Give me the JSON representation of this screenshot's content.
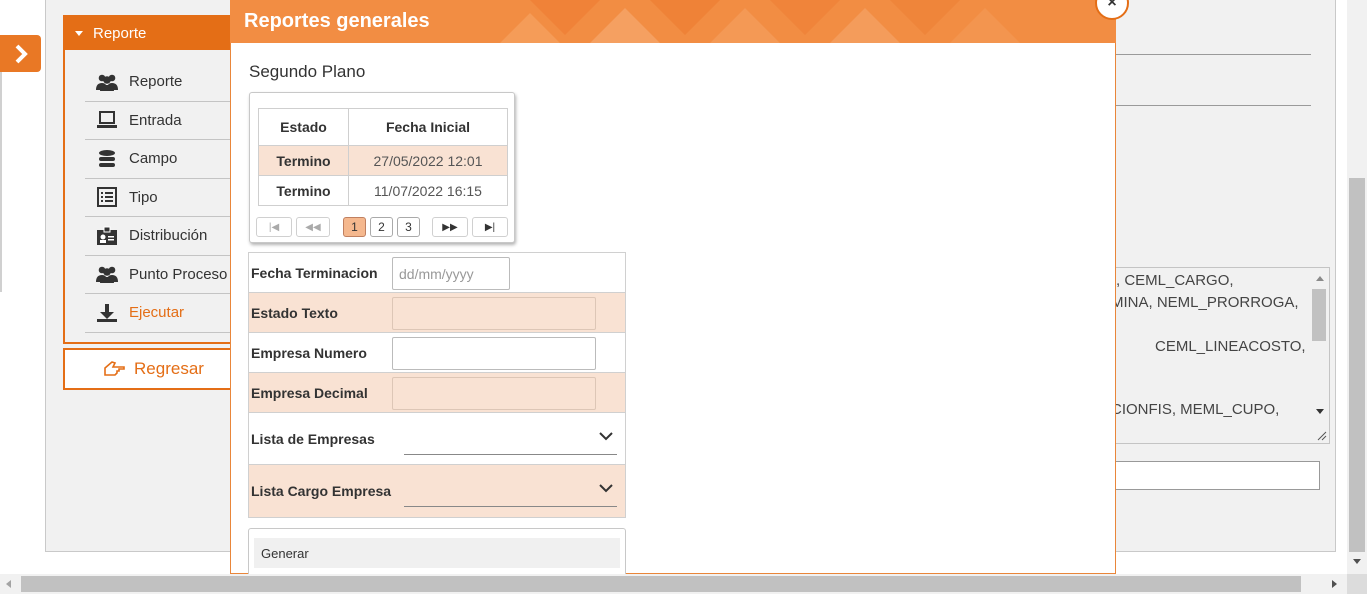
{
  "sidebar": {
    "header": "Reporte",
    "items": [
      {
        "label": "Reporte",
        "icon": "users-icon"
      },
      {
        "label": "Entrada",
        "icon": "laptop-icon"
      },
      {
        "label": "Campo",
        "icon": "database-icon"
      },
      {
        "label": "Tipo",
        "icon": "list-icon"
      },
      {
        "label": "Distribución",
        "icon": "id-badge-icon"
      },
      {
        "label": "Punto Proceso",
        "icon": "users-icon"
      },
      {
        "label": "Ejecutar",
        "icon": "download-icon"
      }
    ],
    "back_button": "Regresar",
    "accent_color": "#e46e16"
  },
  "background": {
    "textarea_lines": [
      ", CEML_CARGO,",
      "MINA,  NEML_PRORROGA,",
      "CEML_LINEACOSTO,",
      "CIONFIS,      MEML_CUPO,"
    ]
  },
  "modal": {
    "title": "Reportes generales",
    "subtitle": "Segundo Plano",
    "grid": {
      "columns": [
        "Estado",
        "Fecha Inicial"
      ],
      "rows": [
        {
          "estado": "Termino",
          "fecha": "27/05/2022 12:01"
        },
        {
          "estado": "Termino",
          "fecha": "11/07/2022 16:15"
        }
      ],
      "pager": {
        "first": "|◀",
        "prev": "◀◀",
        "pages": [
          "1",
          "2",
          "3"
        ],
        "current_page": "1",
        "next": "▶▶",
        "last": "▶|"
      }
    },
    "form": {
      "fecha_terminacion": {
        "label": "Fecha Terminacion",
        "placeholder": "dd/mm/yyyy"
      },
      "estado_texto": {
        "label": "Estado Texto",
        "value": ""
      },
      "empresa_numero": {
        "label": "Empresa Numero",
        "value": ""
      },
      "empresa_decimal": {
        "label": "Empresa Decimal",
        "value": ""
      },
      "lista_empresas": {
        "label": "Lista de Empresas",
        "value": ""
      },
      "lista_cargo_empresa": {
        "label": "Lista Cargo Empresa",
        "value": ""
      }
    },
    "generate_button": "Generar",
    "header_color": "#f28d43"
  }
}
